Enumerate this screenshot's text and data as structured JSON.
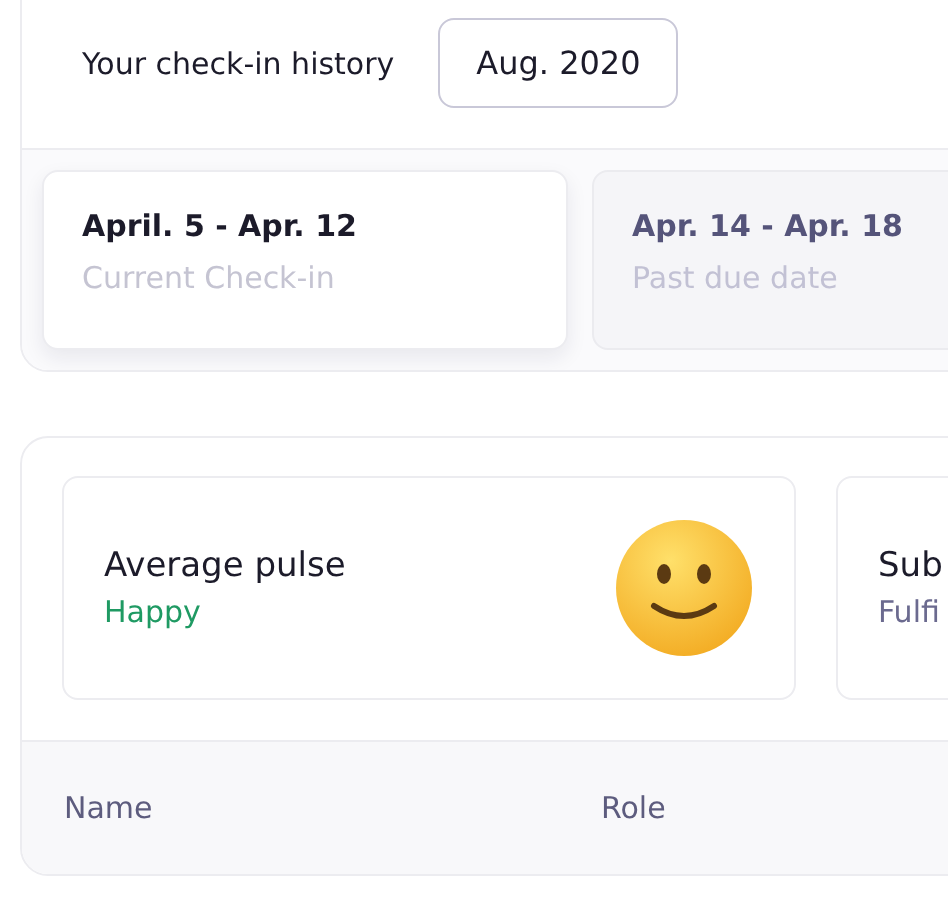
{
  "history": {
    "title": "Your check-in history",
    "month": "Aug. 2020"
  },
  "periods": [
    {
      "range": "April. 5 - Apr. 12",
      "status": "Current Check-in",
      "selected": true
    },
    {
      "range": "Apr. 14 - Apr. 18",
      "status": "Past due date",
      "selected": false
    }
  ],
  "stats": [
    {
      "kind": "emoji",
      "title": "Average pulse",
      "value": "Happy",
      "color": "#1f9a63"
    },
    {
      "kind": "plain",
      "title": "Sub",
      "value": "Fulfi",
      "color": "#6b6a8f"
    }
  ],
  "table": {
    "columns": [
      "Name",
      "Role"
    ]
  }
}
